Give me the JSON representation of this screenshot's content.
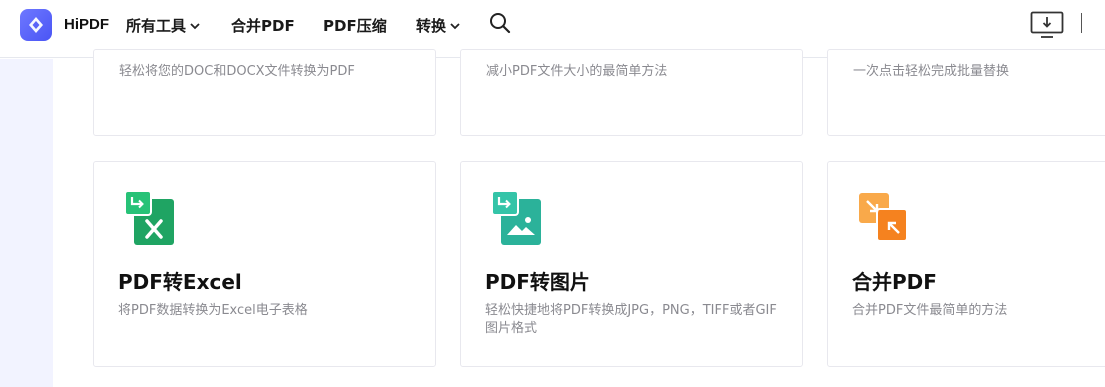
{
  "header": {
    "brand": "HiPDF",
    "nav": [
      {
        "label": "所有工具",
        "has_dropdown": true
      },
      {
        "label": "合并PDF",
        "has_dropdown": false
      },
      {
        "label": "PDF压缩",
        "has_dropdown": false
      },
      {
        "label": "转换",
        "has_dropdown": true
      }
    ],
    "icons": {
      "logo": "hipdf-logo-icon",
      "search": "search-icon",
      "download": "desktop-download-icon",
      "chevron": "chevron-down-icon"
    }
  },
  "cards_top": [
    {
      "desc": "轻松将您的DOC和DOCX文件转换为PDF"
    },
    {
      "desc": "减小PDF文件大小的最简单方法"
    },
    {
      "desc": "一次点击轻松完成批量替换"
    }
  ],
  "cards": [
    {
      "title": "PDF转Excel",
      "desc": "将PDF数据转换为Excel电子表格",
      "icon": "pdf-to-excel-icon"
    },
    {
      "title": "PDF转图片",
      "desc": "轻松快捷地将PDF转换成JPG，PNG，TIFF或者GIF图片格式",
      "icon": "pdf-to-image-icon"
    },
    {
      "title": "合并PDF",
      "desc": "合并PDF文件最简单的方法",
      "icon": "merge-pdf-icon"
    }
  ],
  "colors": {
    "brand": "#5b63f7",
    "excel": "#1fa463",
    "image": "#2bb29a",
    "merge": "#f5821f",
    "sidebar_bg": "#f2f3ff"
  }
}
